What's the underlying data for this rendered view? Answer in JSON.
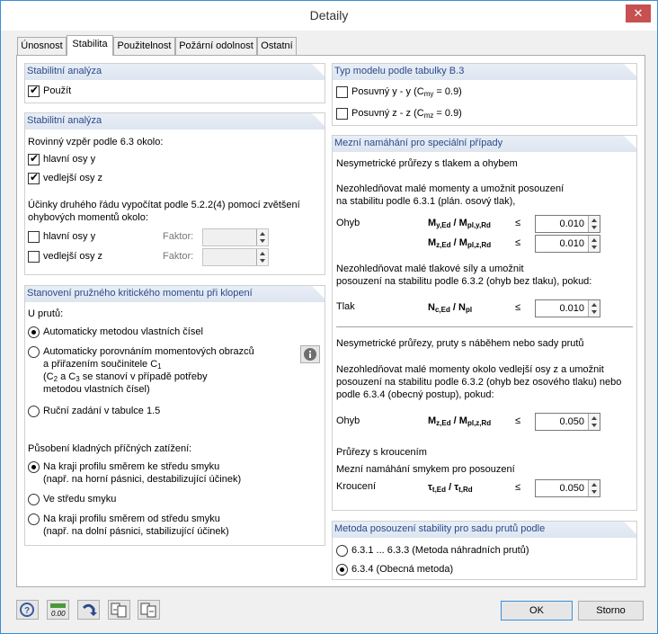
{
  "window": {
    "title": "Detaily",
    "close": "✕"
  },
  "tabs": [
    "Únosnost",
    "Stabilita",
    "Použitelnost",
    "Požární odolnost",
    "Ostatní"
  ],
  "grp1": {
    "title": "Stabilitní analýza",
    "use": "Použít"
  },
  "grp2": {
    "title": "Stabilitní analýza",
    "buckling": "Rovinný vzpěr podle 6.3 okolo:",
    "major": "hlavní osy y",
    "minor": "vedlejší osy z",
    "second_order1": "Účinky druhého řádu vypočítat podle 5.2.2(4) pomocí zvětšení",
    "second_order2": "ohybových momentů okolo:",
    "major2": "hlavní osy y",
    "minor2": "vedlejší osy z",
    "factor": "Faktor:"
  },
  "grp3": {
    "title": "Stanovení pružného kritického momentu při klopení",
    "for_members": "U prutů:",
    "opt1": "Automaticky metodou vlastních čísel",
    "opt2a": "Automaticky porovnáním momentových obrazců",
    "opt2b": "a přiřazením součinitele C",
    "opt2b_sub": "1",
    "opt2c": "(C",
    "opt2c_mid": "2",
    "opt2c_a": " a C",
    "opt2c_mid2": "3",
    "opt2c_b": " se stanoví v případě potřeby",
    "opt2d": "metodou vlastních čísel)",
    "opt3": "Ruční zadání v tabulce 1.5",
    "loads": "Působení kladných příčných zatížení:",
    "l1a": "Na kraji profilu směrem ke středu smyku",
    "l1b": "(např. na horní pásnici, destabilizující účinek)",
    "l2": "Ve středu smyku",
    "l3a": "Na kraji profilu směrem od středu smyku",
    "l3b": "(např. na dolní pásnici, stabilizující účinek)"
  },
  "grp4": {
    "title": "Typ modelu podle tabulky B.3",
    "y": "Posuvný y - y (C",
    "y_sub": "my",
    "y_end": " = 0.9)",
    "z": "Posuvný z - z (C",
    "z_sub": "mz",
    "z_end": " = 0.9)"
  },
  "grp5": {
    "title": "Mezní namáhání pro speciální případy",
    "t1": "Nesymetrické průřezy s tlakem a ohybem",
    "t2a": "Nezohledňovat malé momenty a umožnit posouzení",
    "t2b": "na stabilitu podle 6.3.1 (plán. osový tlak),",
    "ohyb": "Ohyb",
    "f1": "M",
    "f1s": "y,Ed",
    "f1m": " / M",
    "f1s2": "pl,y,Rd",
    "le": "≤",
    "v1": "0.010",
    "f2": "M",
    "f2s": "z,Ed",
    "f2m": " / M",
    "f2s2": "pl,z,Rd",
    "v2": "0.010",
    "t3a": "Nezohledňovat malé tlakové síly a umožnit",
    "t3b": "posouzení na stabilitu podle 6.3.2 (ohyb bez tlaku), pokud:",
    "tlak": "Tlak",
    "f3": "N",
    "f3s": "c,Ed",
    "f3m": " / N",
    "f3s2": "pl",
    "v3": "0.010",
    "t4": "Nesymetrické průřezy, pruty s náběhem nebo sady prutů",
    "t5a": "Nezohledňovat malé momenty okolo vedlejší osy z a umožnit",
    "t5b": "posouzení na stabilitu podle 6.3.2 (ohyb bez osového tlaku) nebo",
    "t5c": "podle 6.3.4 (obecný postup), pokud:",
    "ohyb2": "Ohyb",
    "f4": "M",
    "f4s": "z,Ed",
    "f4m": " / M",
    "f4s2": "pl,z,Rd",
    "v4": "0.050",
    "t6": "Průřezy s kroucením",
    "t7": "Mezní namáhání smykem pro posouzení",
    "krouceni": "Kroucení",
    "f5": "τ",
    "f5s": "t,Ed",
    "f5m": " / τ",
    "f5s2": "t,Rd",
    "v5": "0.050"
  },
  "grp6": {
    "title": "Metoda posouzení stability pro sadu prutů podle",
    "o1": "6.3.1 ... 6.3.3 (Metoda náhradních prutů)",
    "o2": "6.3.4 (Obecná metoda)"
  },
  "buttons": {
    "ok": "OK",
    "cancel": "Storno"
  }
}
